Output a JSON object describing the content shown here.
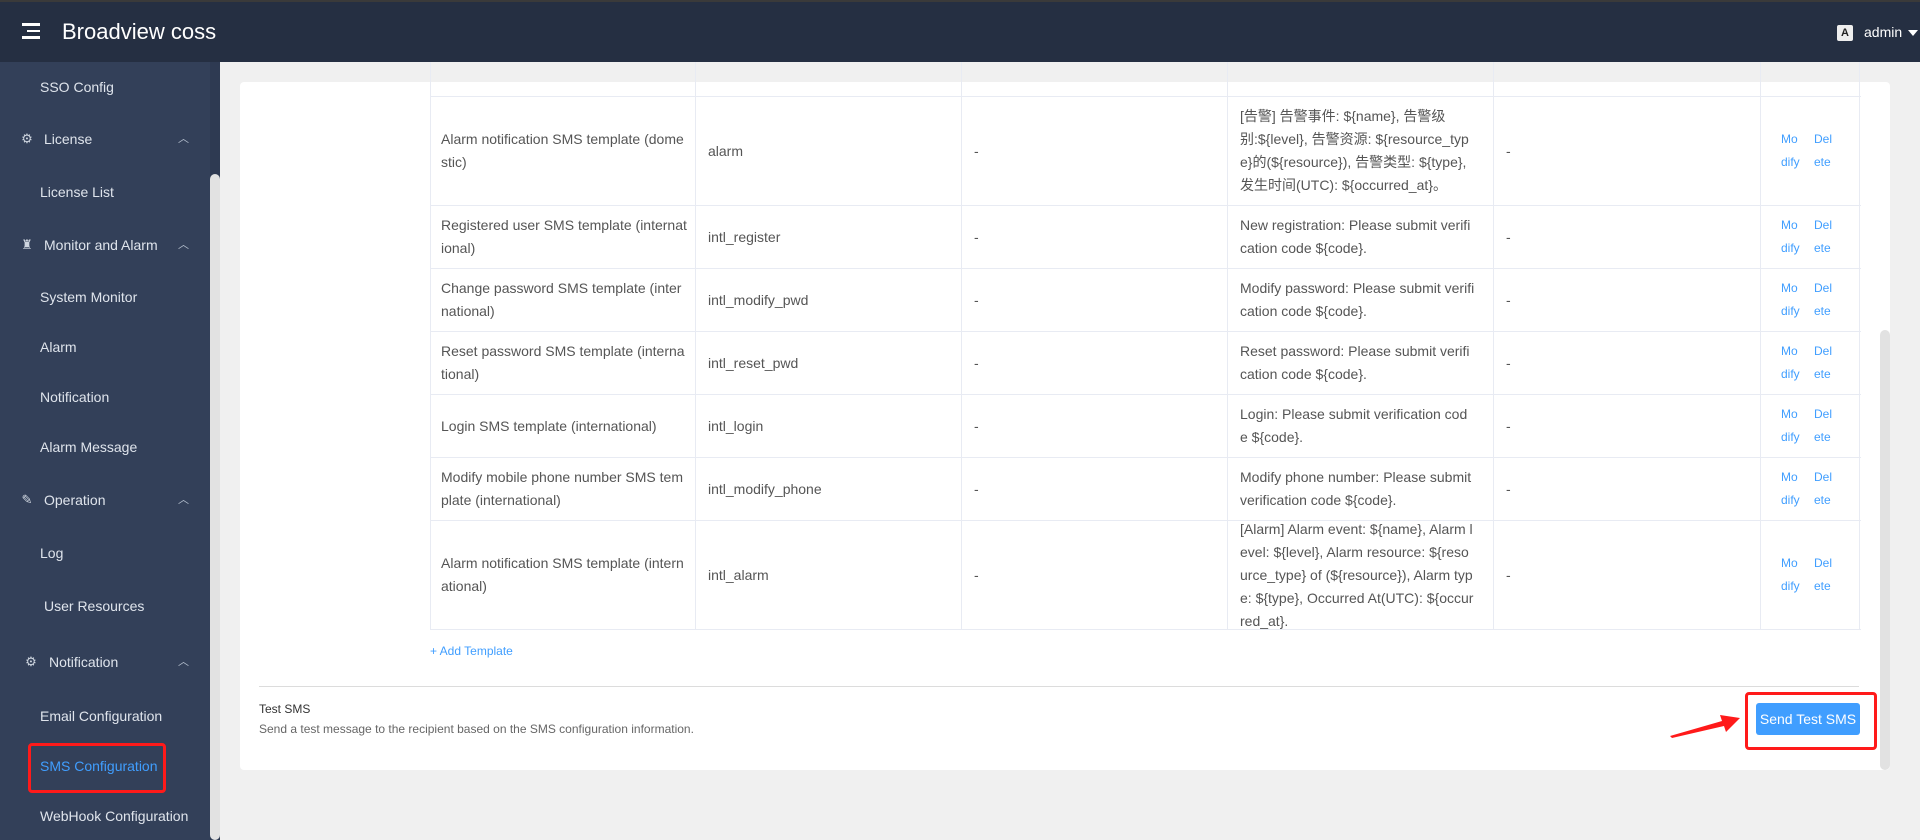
{
  "header": {
    "app_title": "Broadview coss",
    "lang_icon_glyph": "A",
    "user": "admin"
  },
  "sidebar": {
    "items": [
      {
        "label": "SSO Config",
        "type": "sub"
      },
      {
        "label": "License",
        "type": "group",
        "icon": "license-gear-icon"
      },
      {
        "label": "License List",
        "type": "sub"
      },
      {
        "label": "Monitor and Alarm",
        "type": "group",
        "icon": "alarm-light-icon"
      },
      {
        "label": "System Monitor",
        "type": "sub"
      },
      {
        "label": "Alarm",
        "type": "sub"
      },
      {
        "label": "Notification",
        "type": "sub"
      },
      {
        "label": "Alarm Message",
        "type": "sub"
      },
      {
        "label": "Operation",
        "type": "group",
        "icon": "operation-icon"
      },
      {
        "label": "Log",
        "type": "sub"
      },
      {
        "label": "User Resources",
        "type": "sub"
      },
      {
        "label": "Notification",
        "type": "group",
        "icon": "gear-icon"
      },
      {
        "label": "Email Configuration",
        "type": "sub"
      },
      {
        "label": "SMS Configuration",
        "type": "sub",
        "active": true
      },
      {
        "label": "WebHook Configuration",
        "type": "sub"
      }
    ]
  },
  "table": {
    "partial_top_row_text": "…",
    "rows": [
      {
        "name": "Alarm notification SMS template (domestic)",
        "key": "alarm",
        "col3": "-",
        "content": "[告警] 告警事件: ${name}, 告警级别:${level}, 告警资源: ${resource_type}的(${resource}), 告警类型: ${type}, 发生时间(UTC): ${occurred_at}。",
        "col5": "-"
      },
      {
        "name": "Registered user SMS template (international)",
        "key": "intl_register",
        "col3": "-",
        "content": "New registration: Please submit verification code ${code}.",
        "col5": "-"
      },
      {
        "name": "Change password SMS template (international)",
        "key": "intl_modify_pwd",
        "col3": "-",
        "content": "Modify password: Please submit verification code ${code}.",
        "col5": "-"
      },
      {
        "name": "Reset password SMS template (international)",
        "key": "intl_reset_pwd",
        "col3": "-",
        "content": "Reset password: Please submit verification code ${code}.",
        "col5": "-"
      },
      {
        "name": "Login SMS template (international)",
        "key": "intl_login",
        "col3": "-",
        "content": "Login: Please submit verification code ${code}.",
        "col5": "-"
      },
      {
        "name": "Modify mobile phone number SMS template (international)",
        "key": "intl_modify_phone",
        "col3": "-",
        "content": "Modify phone number: Please submit verification code ${code}.",
        "col5": "-"
      },
      {
        "name": "Alarm notification SMS template (international)",
        "key": "intl_alarm",
        "col3": "-",
        "content": "[Alarm] Alarm event: ${name}, Alarm level: ${level}, Alarm resource: ${resource_type} of (${resource}), Alarm type: ${type}, Occurred At(UTC): ${occurred_at}.",
        "col5": "-"
      }
    ],
    "modify_label": "Modify",
    "delete_label": "Delete"
  },
  "add_template_label": "+ Add Template",
  "test_sms": {
    "title": "Test SMS",
    "description": "Send a test message to the recipient based on the SMS configuration information.",
    "button_label": "Send Test SMS"
  },
  "colors": {
    "accent": "#409eff",
    "header_bg": "#252f42",
    "sidebar_bg": "#334059",
    "annotation_red": "#ff1a1a"
  }
}
